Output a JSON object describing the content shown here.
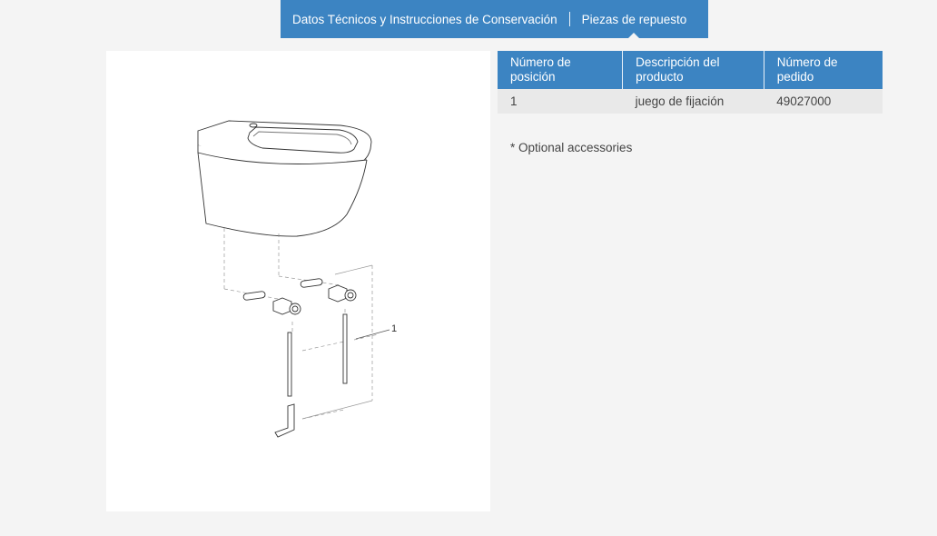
{
  "tabs": [
    {
      "label": "Datos Técnicos y Instrucciones de Conservación"
    },
    {
      "label": "Piezas de repuesto"
    }
  ],
  "drawing": {
    "callout": "1"
  },
  "parts_table": {
    "headers": [
      "Número de posición",
      "Descripción del producto",
      "Número de pedido"
    ],
    "rows": [
      [
        "1",
        "juego de fijación",
        "49027000"
      ]
    ]
  },
  "note": "* Optional accessories",
  "colors": {
    "accent": "#3c84c2",
    "page_bg": "#f4f4f4",
    "row_bg": "#e9e9e9"
  }
}
